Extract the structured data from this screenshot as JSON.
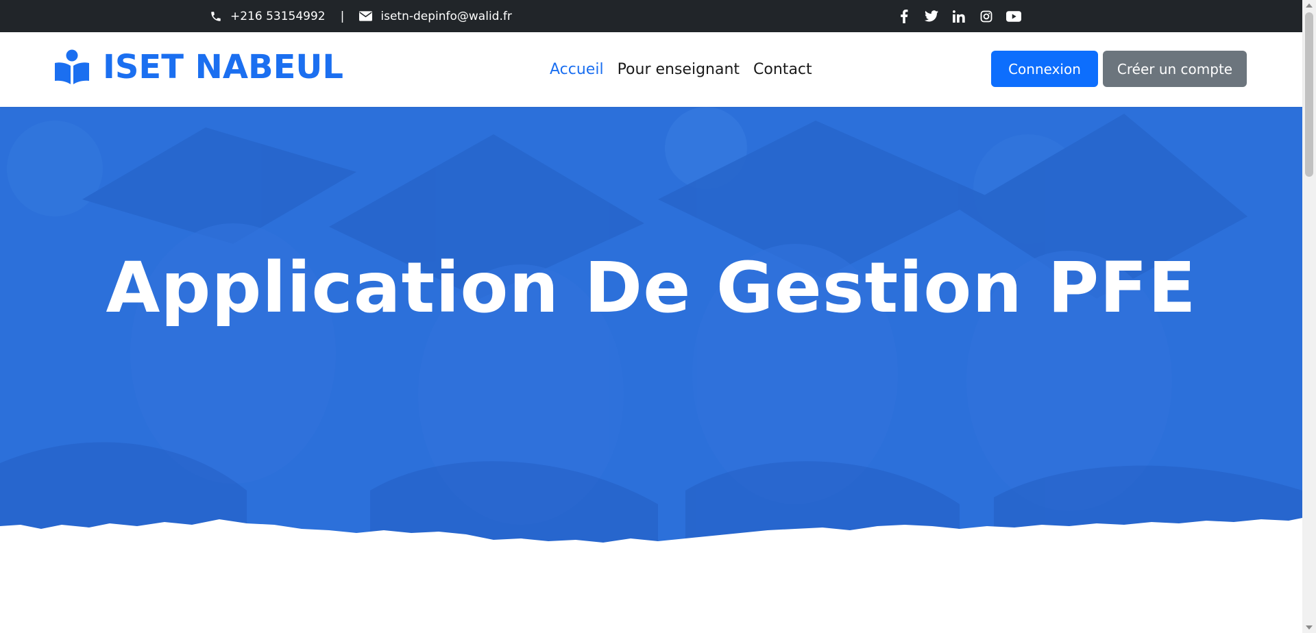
{
  "topbar": {
    "phone": "+216 53154992",
    "separator": "|",
    "email": "isetn-depinfo@walid.fr",
    "social": [
      "facebook-icon",
      "twitter-icon",
      "linkedin-icon",
      "instagram-icon",
      "youtube-icon"
    ]
  },
  "navbar": {
    "brand": "ISET NABEUL",
    "links": [
      {
        "label": "Accueil",
        "active": true
      },
      {
        "label": "Pour enseignant",
        "active": false
      },
      {
        "label": "Contact",
        "active": false
      }
    ],
    "login_label": "Connexion",
    "signup_label": "Créer un compte"
  },
  "hero": {
    "title": "Application De Gestion PFE"
  },
  "colors": {
    "topbar_bg": "#212529",
    "brand": "#1b6ff0",
    "primary_button": "#0d6efd",
    "secondary_button": "#6c757d",
    "hero_overlay": "#2a6ed8"
  }
}
